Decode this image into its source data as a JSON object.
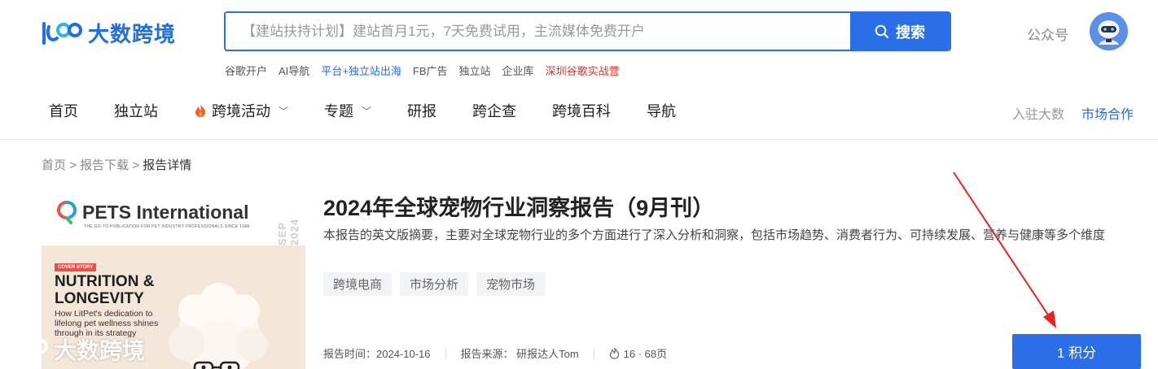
{
  "header": {
    "logo_text": "大数跨境",
    "search_placeholder": "【建站扶持计划】建站首月1元，7天免费试用，主流媒体免费开户",
    "search_button": "搜索",
    "gzh_label": "公众号",
    "hot_links": [
      "谷歌开户",
      "AI导航",
      "平台+独立站出海",
      "FB广告",
      "独立站",
      "企业库",
      "深圳谷歌实战营"
    ]
  },
  "nav": {
    "items": [
      "首页",
      "独立站",
      "跨境活动",
      "专题",
      "研报",
      "跨企查",
      "跨境百科",
      "导航"
    ],
    "join": "入驻大数",
    "market": "市场合作"
  },
  "breadcrumb": {
    "home": "首页",
    "reports": "报告下载",
    "current": "报告详情",
    "sep": ">"
  },
  "cover": {
    "brand": "PETS International",
    "subline": "THE GO-TO PUBLICATION FOR PET INDUSTRY PROFESSIONALS SINCE 1988",
    "issue": "SEP 2024",
    "tag": "COVER STORY",
    "headline_1": "NUTRITION &",
    "headline_2": "LONGEVITY",
    "desc": "How LitPet's dedication to lifelong pet wellness shines through in its strategy"
  },
  "watermark": "大数跨境",
  "report": {
    "title": "2024年全球宠物行业洞察报告（9月刊）",
    "description": "本报告的英文版摘要，主要对全球宠物行业的多个方面进行了深入分析和洞察，包括市场趋势、消费者行为、可持续发展、营养与健康等多个维度",
    "tags": [
      "跨境电商",
      "市场分析",
      "宠物市场"
    ],
    "time": "报告时间：2024-10-16",
    "source": "报告来源：  研报达人Tom",
    "stats": "16 · 68页",
    "buy_label": "1 积分"
  },
  "colors": {
    "brand_blue": "#2a6fe8",
    "hot_red": "#d03a2a",
    "annotation_red": "#e5251f"
  }
}
